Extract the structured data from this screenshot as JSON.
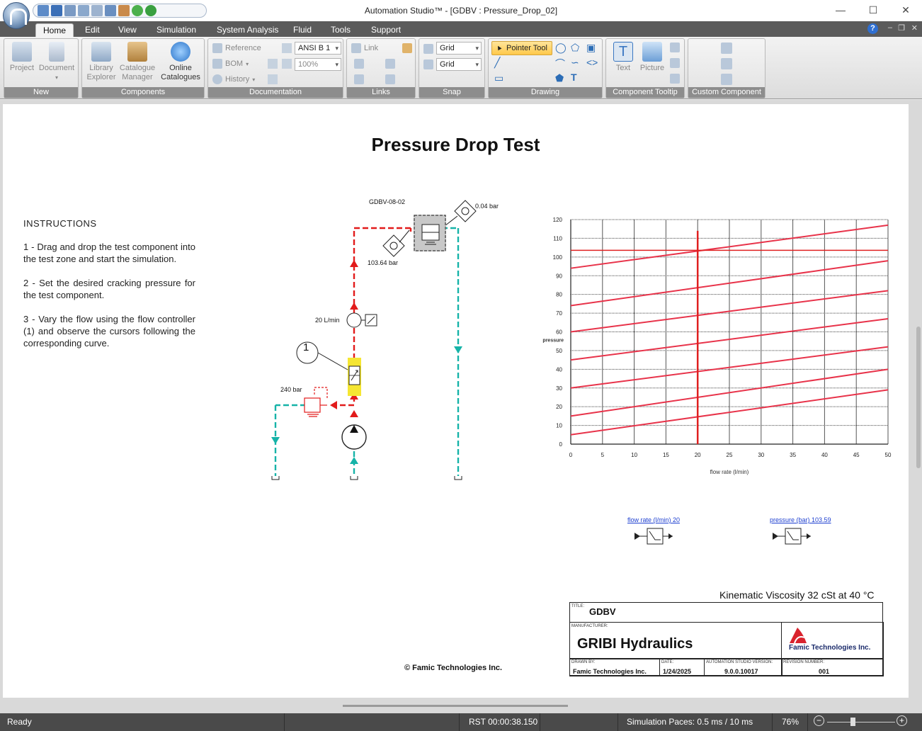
{
  "window": {
    "title": "Automation Studio™ - [GDBV : Pressure_Drop_02]"
  },
  "tabs": [
    "Home",
    "Edit",
    "View",
    "Simulation",
    "System Analysis",
    "Fluid",
    "Tools",
    "Support"
  ],
  "ribbon": {
    "new": {
      "label": "New",
      "project": "Project",
      "document": "Document"
    },
    "components": {
      "label": "Components",
      "library_1": "Library",
      "library_2": "Explorer",
      "catalogue_1": "Catalogue",
      "catalogue_2": "Manager",
      "online_1": "Online",
      "online_2": "Catalogues"
    },
    "documentation": {
      "label": "Documentation",
      "reference": "Reference",
      "bom": "BOM",
      "history": "History",
      "standard": "ANSI B",
      "standard_num": "1",
      "zoom": "100%"
    },
    "links": {
      "label": "Links",
      "link": "Link"
    },
    "snap": {
      "label": "Snap",
      "grid1": "Grid",
      "grid2": "Grid"
    },
    "drawing": {
      "label": "Drawing",
      "pointer_tool": "Pointer Tool"
    },
    "component_tooltip": {
      "label": "Component Tooltip",
      "text": "Text",
      "picture": "Picture"
    },
    "custom_component": {
      "label": "Custom Component"
    }
  },
  "page": {
    "title": "Pressure Drop Test",
    "instructions": {
      "heading": "INSTRUCTIONS",
      "steps": [
        "1 - Drag and drop the test component into the test zone and start the simulation.",
        "2 - Set the desired cracking pressure for the test component.",
        "3 - Vary the flow using the flow controller (1) and observe the cursors following the corresponding curve."
      ]
    },
    "circuit": {
      "component_id": "GDBV-08-02",
      "outlet_pressure": "0.04 bar",
      "inlet_pressure": "103.64 bar",
      "flow": "20 L/min",
      "controller_number": "1",
      "relief_setting": "240 bar"
    },
    "meters": {
      "flow_rate": "flow rate (l/min) 20",
      "pressure": "pressure (bar) 103.59"
    },
    "viscosity": "Kinematic Viscosity 32 cSt at 40 °C",
    "titleblock": {
      "title_caption": "TITLE:",
      "title": "GDBV",
      "manufacturer_caption": "MANUFACTURER:",
      "manufacturer": "GRIBI Hydraulics",
      "logo_text": "Famic Technologies Inc.",
      "drawn_by_caption": "DRAWN BY:",
      "drawn_by": "Famic Technologies Inc.",
      "date_caption": "DATE:",
      "date": "1/24/2025",
      "version_caption": "AUTOMATION STUDIO VERSION:",
      "version": "9.0.0.10017",
      "revision_caption": "REVISION NUMBER:",
      "revision": "001"
    },
    "copyright": "© Famic Technologies Inc."
  },
  "chart_data": {
    "type": "line",
    "xlabel": "flow rate (l/min)",
    "ylabel": "pressure",
    "x_ticks": [
      "0",
      "5",
      "10",
      "15",
      "20",
      "25",
      "30",
      "35",
      "40",
      "45",
      "50"
    ],
    "y_ticks": [
      "0",
      "10",
      "20",
      "30",
      "40",
      "50",
      "60",
      "70",
      "80",
      "90",
      "100",
      "110",
      "120"
    ],
    "xlim": [
      0,
      50
    ],
    "ylim": [
      0,
      120
    ],
    "grid": true,
    "cursor": {
      "x": 20,
      "y": 103.59
    },
    "series": [
      {
        "values": [
          [
            0,
            5
          ],
          [
            50,
            29
          ]
        ]
      },
      {
        "values": [
          [
            0,
            15
          ],
          [
            50,
            40
          ]
        ]
      },
      {
        "values": [
          [
            0,
            30
          ],
          [
            50,
            52
          ]
        ]
      },
      {
        "values": [
          [
            0,
            45
          ],
          [
            50,
            67
          ]
        ]
      },
      {
        "values": [
          [
            0,
            60
          ],
          [
            50,
            82
          ]
        ]
      },
      {
        "values": [
          [
            0,
            74
          ],
          [
            50,
            98
          ]
        ]
      },
      {
        "values": [
          [
            0,
            94
          ],
          [
            50,
            117
          ]
        ]
      }
    ],
    "colors": {
      "curve": "#e8334a",
      "cursor": "#e02020"
    }
  },
  "statusbar": {
    "state": "Ready",
    "rst": "RST 00:00:38.150",
    "paces": "Simulation Paces: 0.5 ms / 10 ms",
    "zoom": "76%"
  }
}
